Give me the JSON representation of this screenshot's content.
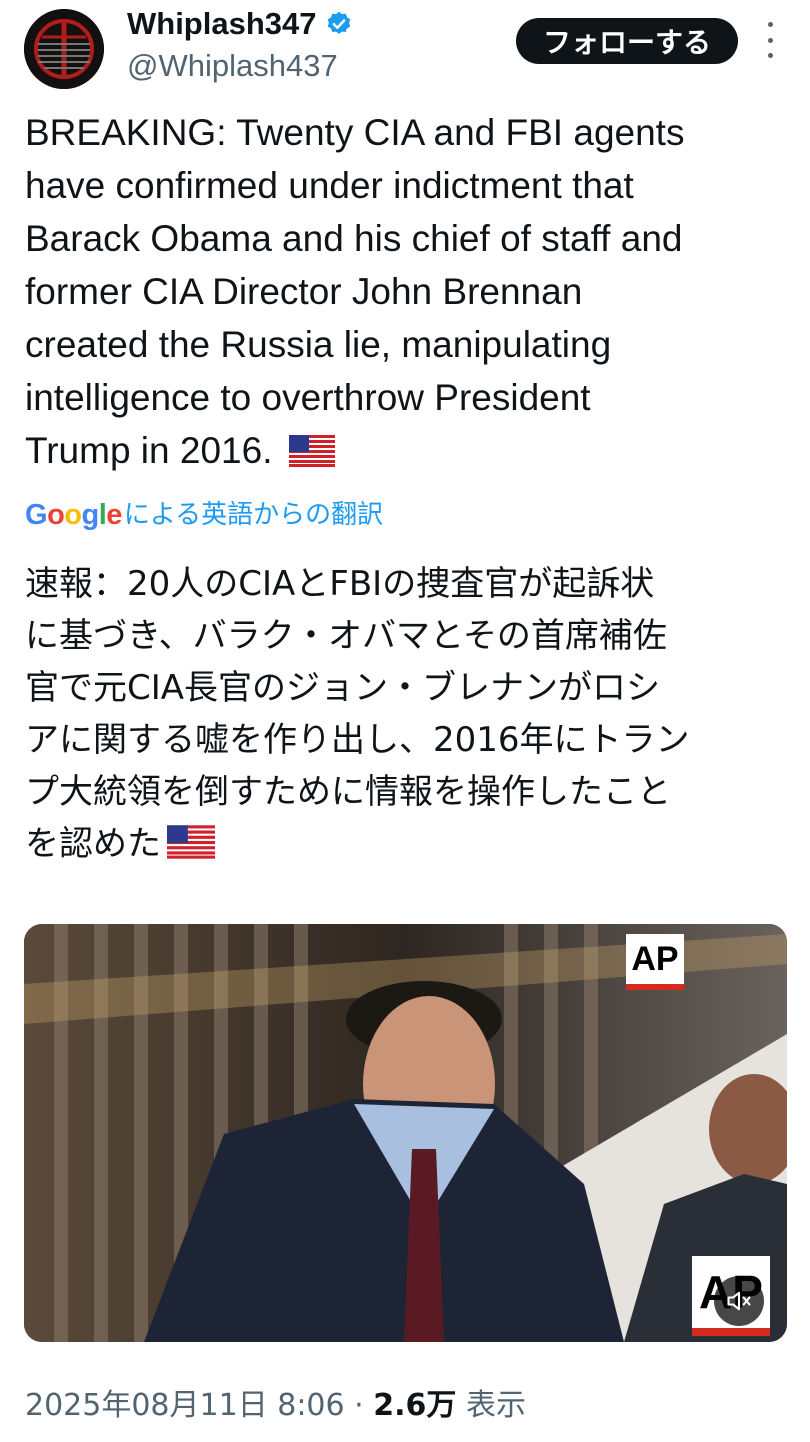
{
  "author": {
    "display_name": "Whiplash347",
    "handle": "@Whiplash437",
    "verified_color": "#1d9bf0",
    "follow_label": "フォローする"
  },
  "tweet": {
    "text": "BREAKING: Twenty CIA and FBI agents\nhave confirmed under indictment that\nBarack Obama and his chief of staff and\nformer CIA Director John Brennan\ncreated the Russia lie, manipulating\nintelligence to overthrow President\nTrump in 2016.",
    "translate_logo": "Google",
    "translate_label": "による英語からの翻訳",
    "translation": "速報：20人のCIAとFBIの捜査官が起訴状\nに基づき、バラク・オバマとその首席補佐\n官で元CIA長官のジョン・ブレナンがロシ\nアに関する嘘を作り出し、2016年にトラン\nプ大統領を倒すために情報を操作したこと\nを認めた"
  },
  "media": {
    "watermark_top": "AP",
    "watermark_bottom": "AP",
    "mute_icon": "speaker-muted-icon"
  },
  "meta": {
    "timestamp": "2025年08月11日 8:06",
    "separator": "·",
    "views_count": "2.6万",
    "views_label": "表示"
  }
}
